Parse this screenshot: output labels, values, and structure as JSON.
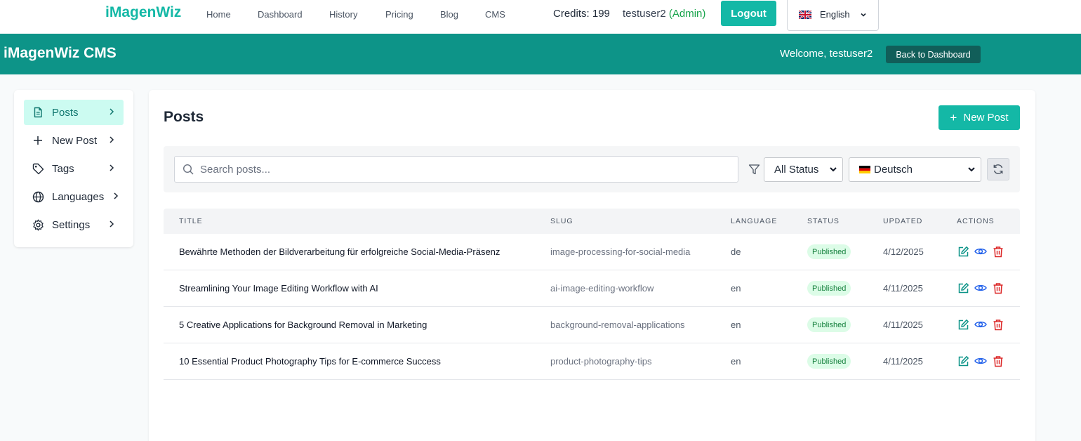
{
  "app": {
    "brand": "iMagenWiz",
    "nav": [
      "Home",
      "Dashboard",
      "History",
      "Pricing",
      "Blog",
      "CMS"
    ],
    "credits": "Credits: 199",
    "username": "testuser2",
    "role": "(Admin)",
    "logout_label": "Logout",
    "language": "English"
  },
  "cms": {
    "title": "iMagenWiz CMS",
    "welcome": "Welcome, testuser2",
    "back_label": "Back to Dashboard"
  },
  "sidebar": {
    "items": [
      {
        "label": "Posts",
        "icon": "document-icon"
      },
      {
        "label": "New Post",
        "icon": "plus-icon"
      },
      {
        "label": "Tags",
        "icon": "tag-icon"
      },
      {
        "label": "Languages",
        "icon": "globe-icon"
      },
      {
        "label": "Settings",
        "icon": "gear-icon"
      }
    ]
  },
  "main": {
    "title": "Posts",
    "new_post_label": "New Post",
    "search_placeholder": "Search posts...",
    "status_filter": "All Status",
    "language_filter": "Deutsch"
  },
  "table": {
    "headers": [
      "TITLE",
      "SLUG",
      "LANGUAGE",
      "STATUS",
      "UPDATED",
      "ACTIONS"
    ],
    "rows": [
      {
        "title": "Bewährte Methoden der Bildverarbeitung für erfolgreiche Social-Media-Präsenz",
        "slug": "image-processing-for-social-media",
        "language": "de",
        "status": "Published",
        "updated": "4/12/2025"
      },
      {
        "title": "Streamlining Your Image Editing Workflow with AI",
        "slug": "ai-image-editing-workflow",
        "language": "en",
        "status": "Published",
        "updated": "4/11/2025"
      },
      {
        "title": "5 Creative Applications for Background Removal in Marketing",
        "slug": "background-removal-applications",
        "language": "en",
        "status": "Published",
        "updated": "4/11/2025"
      },
      {
        "title": "10 Essential Product Photography Tips for E-commerce Success",
        "slug": "product-photography-tips",
        "language": "en",
        "status": "Published",
        "updated": "4/11/2025"
      }
    ]
  },
  "colors": {
    "accent": "#14b8a6",
    "header": "#0d9488",
    "published_bg": "#dcfce7",
    "published_text": "#15803d"
  }
}
